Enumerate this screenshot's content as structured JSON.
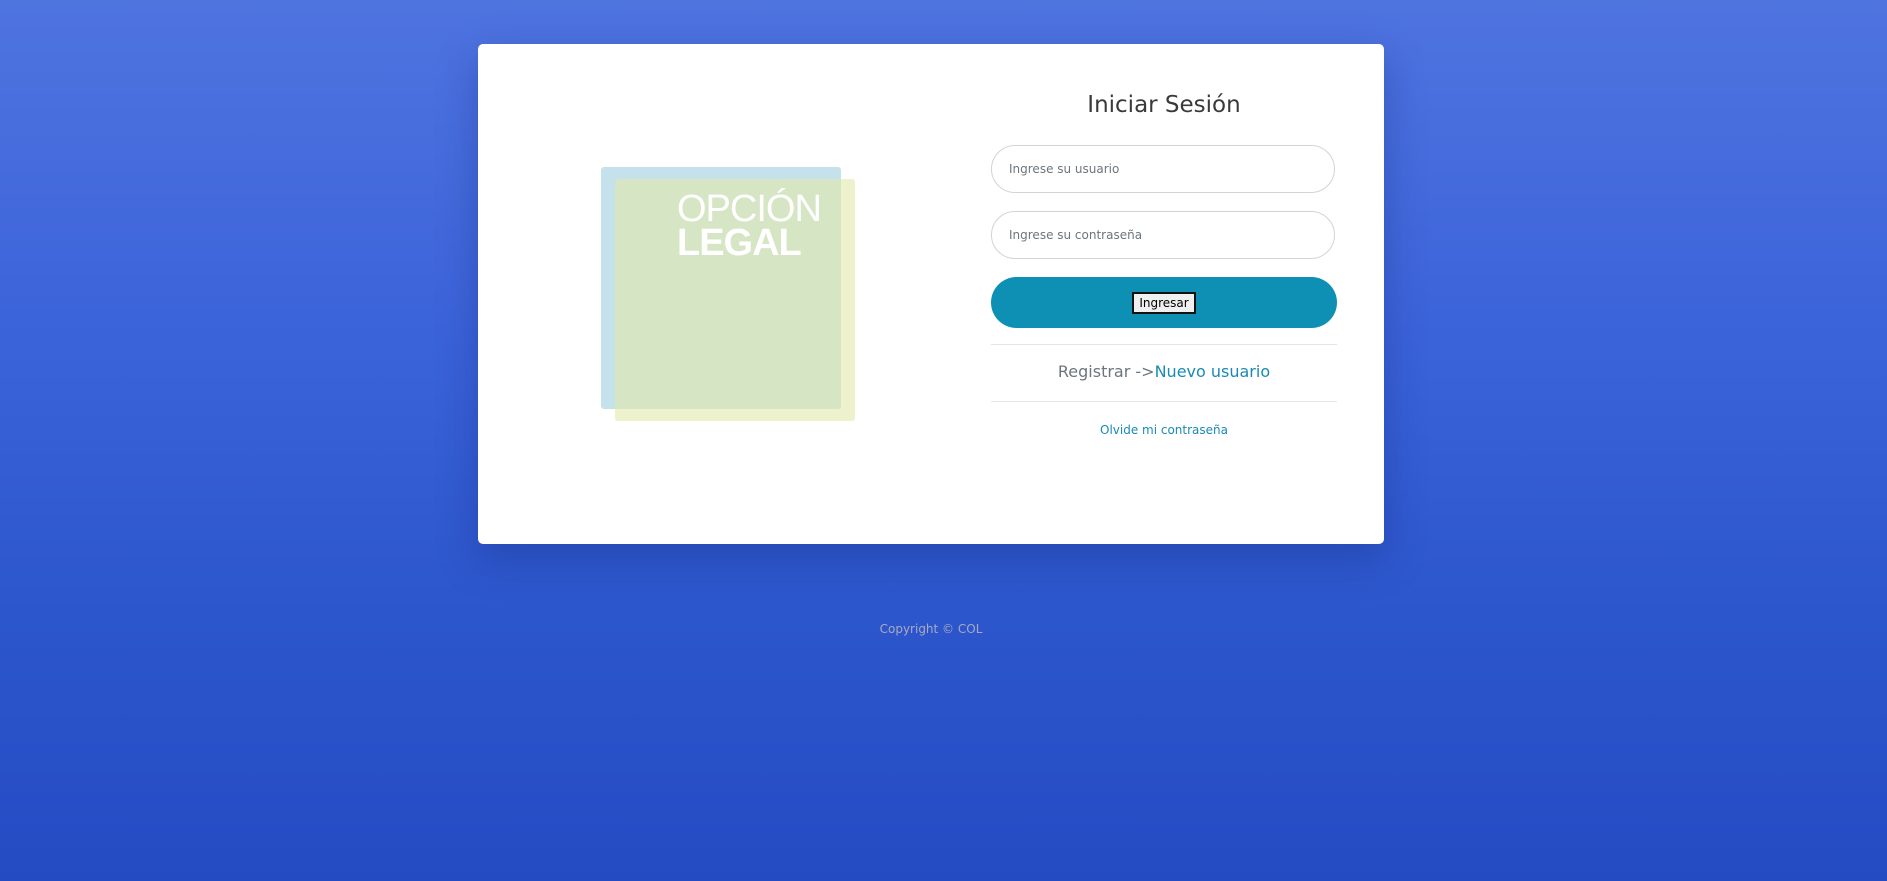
{
  "login": {
    "logo_line1": "OPCIÓN",
    "logo_line2": "LEGAL",
    "title": "Iniciar Sesión",
    "username_placeholder": "Ingrese su usuario",
    "username_value": "",
    "password_placeholder": "Ingrese su contraseña",
    "password_value": "",
    "submit_label": "Ingresar",
    "register_prefix": "Registrar ->",
    "register_link": "Nuevo usuario",
    "forgot_link": "Olvide mi contraseña"
  },
  "footer": {
    "copyright": "Copyright © COL"
  },
  "colors": {
    "background_top": "#4f74e0",
    "background_bottom": "#254bc3",
    "button": "#0e90b5",
    "link": "#1a8ab5",
    "logo_back": "#a6d2e2",
    "logo_front": "#e1e8aa"
  }
}
